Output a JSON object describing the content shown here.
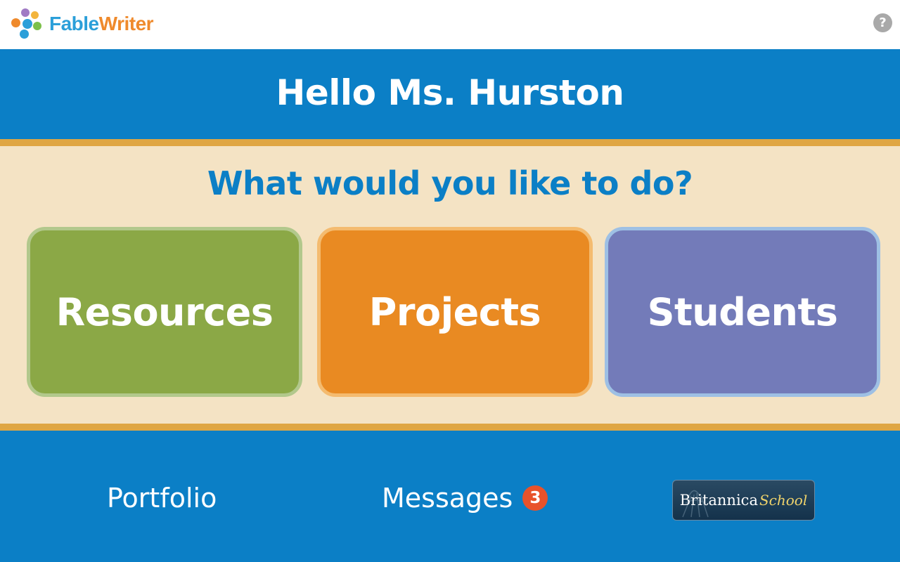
{
  "app": {
    "logo_part1": "Fable",
    "logo_part2": "Writer",
    "help_label": "?"
  },
  "header": {
    "greeting": "Hello Ms. Hurston"
  },
  "main": {
    "question": "What would you like to do?",
    "tiles": [
      {
        "label": "Resources",
        "color": "#8ba846"
      },
      {
        "label": "Projects",
        "color": "#e98a22"
      },
      {
        "label": "Students",
        "color": "#737bb9"
      }
    ]
  },
  "footer": {
    "portfolio_label": "Portfolio",
    "messages_label": "Messages",
    "messages_count": "3",
    "britannica_label": "Britannica",
    "britannica_school": "School"
  },
  "colors": {
    "primary_blue": "#0b7fc6",
    "gold": "#dfa643",
    "cream": "#f4e3c4",
    "badge": "#e8522a"
  }
}
